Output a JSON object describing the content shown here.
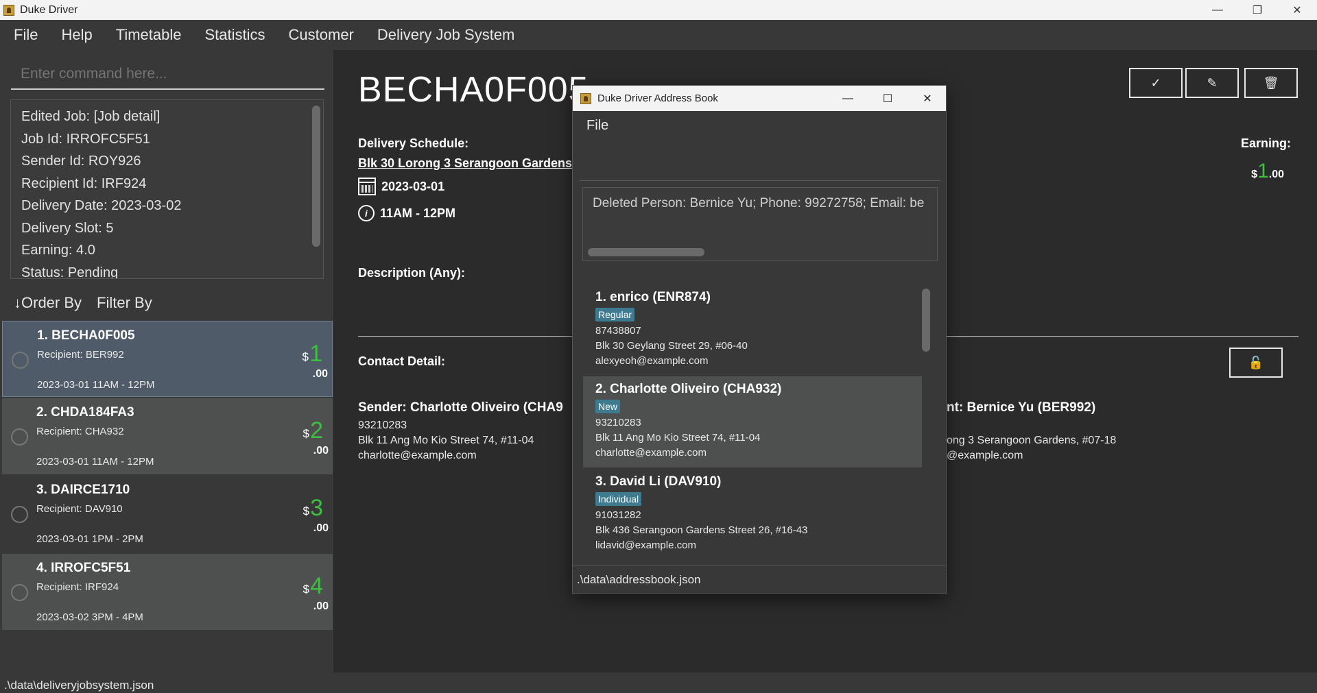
{
  "window": {
    "title": "Duke Driver",
    "minimize": "—",
    "restore": "❐",
    "close": "✕"
  },
  "menu": [
    "File",
    "Help",
    "Timetable",
    "Statistics",
    "Customer",
    "Delivery Job System"
  ],
  "command": {
    "placeholder": "Enter command here..."
  },
  "result": {
    "lines": [
      "Edited Job: [Job detail]",
      "Job Id: IRROFC5F51",
      "Sender Id: ROY926",
      "Recipient Id: IRF924",
      "Delivery Date: 2023-03-02",
      "Delivery Slot: 5",
      "Earning: 4.0",
      "Status: Pending"
    ]
  },
  "list_controls": {
    "order_by": "↓Order By",
    "filter_by": "Filter By"
  },
  "jobs": [
    {
      "title": "1.  BECHA0F005",
      "recipient": "Recipient: BER992",
      "time": "2023-03-01 11AM - 12PM",
      "dollar": "$",
      "earning": "1",
      "cents": ".00"
    },
    {
      "title": "2.  CHDA184FA3",
      "recipient": "Recipient: CHA932",
      "time": "2023-03-01 11AM - 12PM",
      "dollar": "$",
      "earning": "2",
      "cents": ".00"
    },
    {
      "title": "3.  DAIRCE1710",
      "recipient": "Recipient: DAV910",
      "time": "2023-03-01 1PM  - 2PM",
      "dollar": "$",
      "earning": "3",
      "cents": ".00"
    },
    {
      "title": "4.  IRROFC5F51",
      "recipient": "Recipient: IRF924",
      "time": "2023-03-02 3PM  - 4PM",
      "dollar": "$",
      "earning": "4",
      "cents": ".00"
    }
  ],
  "detail": {
    "job_id": "BECHA0F005",
    "actions": {
      "complete": "✓",
      "edit": "✎",
      "delete": "🗑"
    },
    "schedule_label": "Delivery Schedule:",
    "address": "Blk 30 Lorong 3 Serangoon Gardens, #",
    "date": "2023-03-01",
    "clock_glyph": "i",
    "slot": "11AM - 12PM",
    "description_label": "Description (Any):",
    "earning_label": "Earning:",
    "earning_dollar": "$",
    "earning_value": "1",
    "earning_cents": ".00",
    "contact_label": "Contact Detail:",
    "lock": "🔓",
    "sender": {
      "heading": "Sender:  Charlotte Oliveiro    (CHA9",
      "phone": "93210283",
      "address": "Blk 11 Ang Mo Kio Street 74, #11-04",
      "email": "charlotte@example.com"
    },
    "recipient": {
      "heading": "nt:  Bernice Yu    (BER992)",
      "address": "ong 3 Serangoon Gardens, #07-18",
      "email": "@example.com"
    }
  },
  "status_file": ".\\data\\deliveryjobsystem.json",
  "address_book": {
    "title": "Duke Driver Address Book",
    "minimize": "—",
    "maximize": "☐",
    "close": "✕",
    "menu_file": "File",
    "result": "Deleted Person: Bernice Yu; Phone: 99272758; Email: be",
    "persons": [
      {
        "name": "1.  enrico    (ENR874)",
        "tag": "Regular",
        "phone": "87438807",
        "address": "Blk 30 Geylang Street 29, #06-40",
        "email": "alexyeoh@example.com"
      },
      {
        "name": "2.  Charlotte Oliveiro    (CHA932)",
        "tag": "New",
        "phone": "93210283",
        "address": "Blk 11 Ang Mo Kio Street 74, #11-04",
        "email": "charlotte@example.com"
      },
      {
        "name": "3.  David Li    (DAV910)",
        "tag": "Individual",
        "phone": "91031282",
        "address": "Blk 436 Serangoon Gardens Street 26, #16-43",
        "email": "lidavid@example.com"
      }
    ],
    "status_file": ".\\data\\addressbook.json"
  }
}
